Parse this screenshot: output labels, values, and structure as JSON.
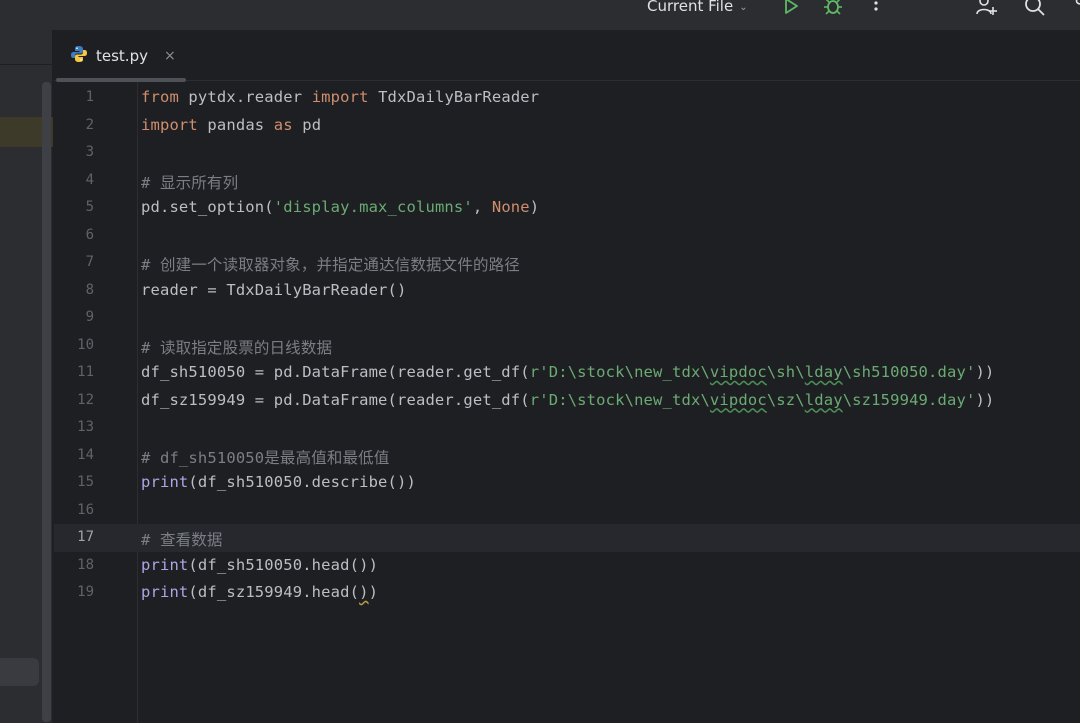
{
  "toolbar": {
    "run_config_label": "Current File",
    "icons": [
      "run-icon",
      "debug-icon",
      "more-icon",
      "add-user-icon",
      "search-icon"
    ]
  },
  "tab": {
    "file_name": "test.py",
    "close_glyph": "×"
  },
  "editor": {
    "current_line": 17,
    "lines": [
      {
        "n": "1"
      },
      {
        "n": "2"
      },
      {
        "n": "3"
      },
      {
        "n": "4"
      },
      {
        "n": "5"
      },
      {
        "n": "6"
      },
      {
        "n": "7"
      },
      {
        "n": "8"
      },
      {
        "n": "9"
      },
      {
        "n": "10"
      },
      {
        "n": "11"
      },
      {
        "n": "12"
      },
      {
        "n": "13"
      },
      {
        "n": "14"
      },
      {
        "n": "15"
      },
      {
        "n": "16"
      },
      {
        "n": "17"
      },
      {
        "n": "18"
      },
      {
        "n": "19"
      }
    ],
    "code": {
      "l1": [
        "from",
        " pytdx.reader ",
        "import",
        " TdxDailyBarReader"
      ],
      "l2": [
        "import",
        " pandas ",
        "as",
        " pd"
      ],
      "l4": "# 显示所有列",
      "l5": [
        "pd.set_option(",
        "'display.max_columns'",
        ", ",
        "None",
        ")"
      ],
      "l7": "# 创建一个读取器对象，并指定通达信数据文件的路径",
      "l8": "reader = TdxDailyBarReader()",
      "l10": "# 读取指定股票的日线数据",
      "l11": [
        "df_sh510050 = pd.DataFrame(reader.get_df(",
        "r'D:\\stock\\new_tdx\\",
        "vipdoc",
        "\\sh\\",
        "lday",
        "\\sh510050.day'",
        "))"
      ],
      "l12": [
        "df_sz159949 = pd.DataFrame(reader.get_df(",
        "r'D:\\stock\\new_tdx\\",
        "vipdoc",
        "\\sz\\",
        "lday",
        "\\sz159949.day'",
        "))"
      ],
      "l14": "# df_sh510050是最高值和最低值",
      "l15": [
        "print",
        "(df_sh510050.describe())"
      ],
      "l17": "# 查看数据",
      "l18": [
        "print",
        "(df_sh510050.head())"
      ],
      "l19": [
        "print",
        "(df_sz159949.head(",
        ")",
        ")"
      ]
    }
  },
  "colors": {
    "background": "#1e1f22",
    "keyword": "#cf8e6d",
    "string": "#6aab73",
    "comment": "#7a7e85",
    "builtin": "#b0a3e6",
    "run_green": "#5fb865"
  }
}
